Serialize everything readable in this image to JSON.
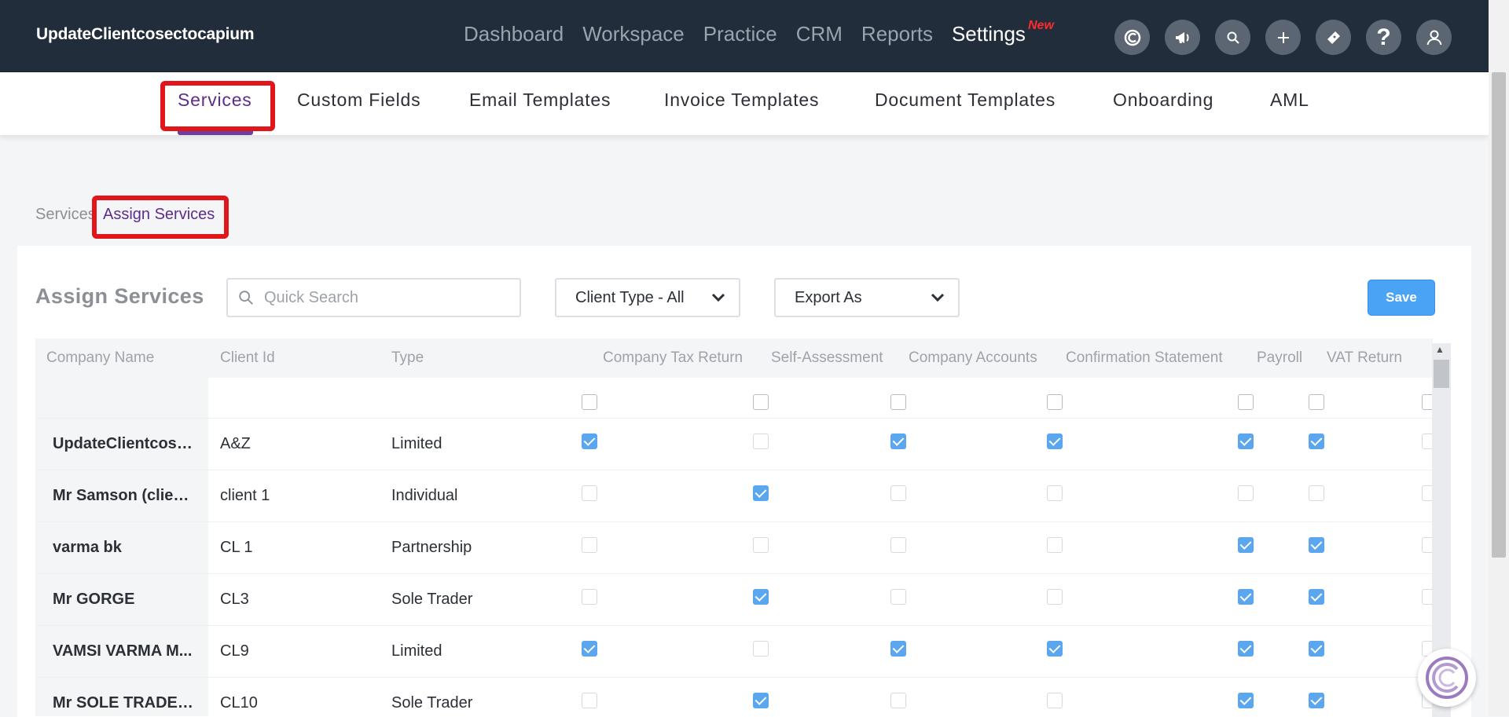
{
  "app": {
    "name": "UpdateClientcosectocapium"
  },
  "main_nav": [
    {
      "label": "Dashboard",
      "active": false
    },
    {
      "label": "Workspace",
      "active": false
    },
    {
      "label": "Practice",
      "active": false
    },
    {
      "label": "CRM",
      "active": false
    },
    {
      "label": "Reports",
      "active": false
    },
    {
      "label": "Settings",
      "active": true
    }
  ],
  "new_badge": "New",
  "header_icons": [
    "capium-logo-icon",
    "megaphone-icon",
    "search-icon",
    "plus-icon",
    "ticket-icon",
    "help-icon",
    "user-icon"
  ],
  "settings_nav": [
    {
      "label": "Services",
      "active": true
    },
    {
      "label": "Custom Fields"
    },
    {
      "label": "Email Templates"
    },
    {
      "label": "Invoice Templates"
    },
    {
      "label": "Document Templates"
    },
    {
      "label": "Onboarding"
    },
    {
      "label": "AML"
    }
  ],
  "breadcrumb": {
    "parent": "Services",
    "current": "Assign Services"
  },
  "page": {
    "title": "Assign Services",
    "search_placeholder": "Quick Search",
    "client_type_filter": "Client Type - All",
    "export_label": "Export As",
    "save_label": "Save"
  },
  "table": {
    "columns": [
      "Company Name",
      "Client Id",
      "Type",
      "Company Tax Return",
      "Self-Assessment",
      "Company Accounts",
      "Confirmation Statement",
      "Payroll",
      "VAT Return"
    ],
    "rows": [
      {
        "name": "UpdateClientcose...",
        "client_id": "A&Z",
        "type": "Limited",
        "services": [
          true,
          false,
          true,
          true,
          true,
          true
        ]
      },
      {
        "name": "Mr Samson (client...",
        "client_id": "client 1",
        "type": "Individual",
        "services": [
          false,
          true,
          false,
          false,
          false,
          false
        ]
      },
      {
        "name": "varma bk",
        "client_id": "CL 1",
        "type": "Partnership",
        "services": [
          false,
          false,
          false,
          false,
          true,
          true
        ]
      },
      {
        "name": "Mr GORGE",
        "client_id": "CL3",
        "type": "Sole Trader",
        "services": [
          false,
          true,
          false,
          false,
          true,
          true
        ]
      },
      {
        "name": "VAMSI VARMA M...",
        "client_id": "CL9",
        "type": "Limited",
        "services": [
          true,
          false,
          true,
          true,
          true,
          true
        ]
      },
      {
        "name": "Mr SOLE TRADER...",
        "client_id": "CL10",
        "type": "Sole Trader",
        "services": [
          false,
          true,
          false,
          false,
          true,
          true
        ]
      }
    ]
  },
  "colors": {
    "topbar": "#222d3b",
    "accent": "#5b2e8c",
    "save": "#4aa3f5",
    "highlight": "#e0161b"
  }
}
